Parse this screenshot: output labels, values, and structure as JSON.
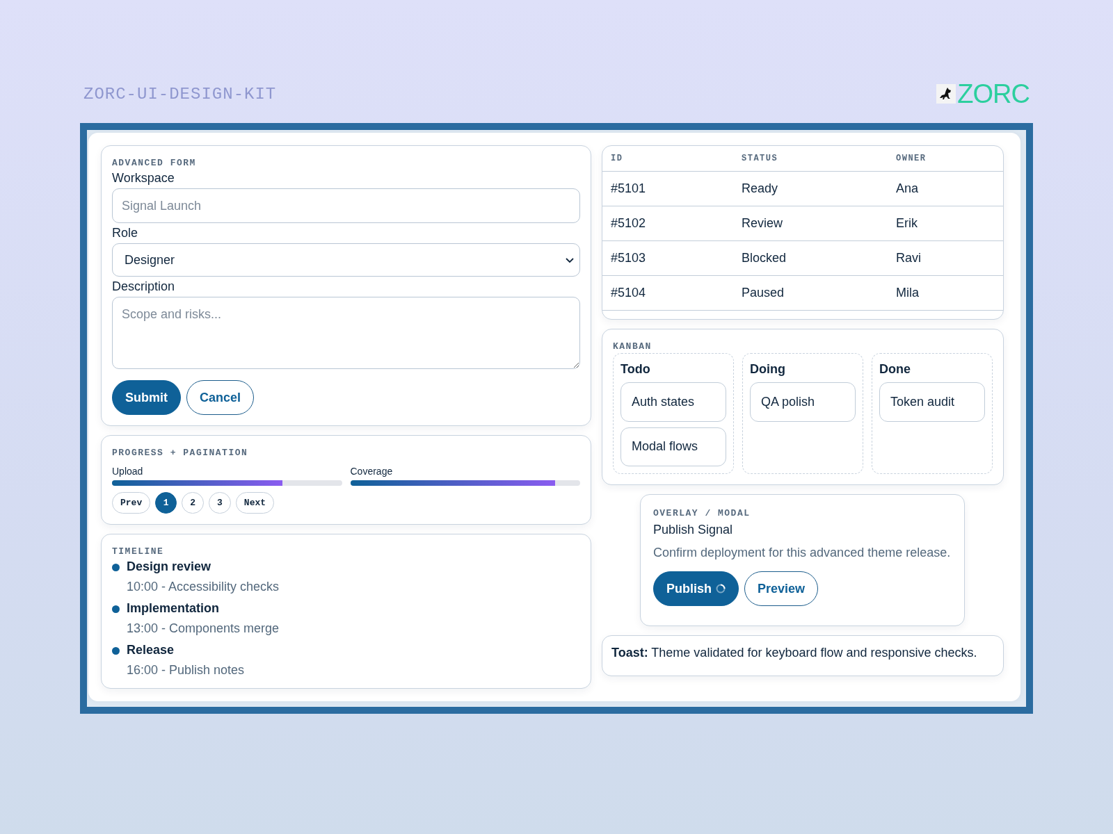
{
  "header": {
    "title": "ZORC-UI-DESIGN-KIT",
    "logo": "ZORC"
  },
  "form": {
    "heading": "ADVANCED FORM",
    "fields": [
      {
        "kind": "input",
        "label": "Workspace",
        "placeholder": "Signal Launch"
      },
      {
        "kind": "select",
        "label": "Role",
        "value": "Designer"
      },
      {
        "kind": "textarea",
        "label": "Description",
        "placeholder": "Scope and risks..."
      }
    ],
    "buttons": [
      {
        "kind": "primary",
        "label": "Submit"
      },
      {
        "kind": "secondary",
        "label": "Cancel"
      }
    ]
  },
  "progress": {
    "heading": "PROGRESS + PAGINATION",
    "bars": [
      {
        "label": "Upload",
        "level": 0.74
      },
      {
        "label": "Coverage",
        "level": 0.89
      }
    ],
    "pagination": [
      {
        "label": "Prev",
        "selected": false
      },
      {
        "label": "1",
        "selected": true
      },
      {
        "label": "2",
        "selected": false
      },
      {
        "label": "3",
        "selected": false
      },
      {
        "label": "Next",
        "selected": false
      }
    ]
  },
  "timeline": {
    "heading": "TIMELINE",
    "events": [
      {
        "title": "Design review",
        "detail": "10:00 - Accessibility checks"
      },
      {
        "title": "Implementation",
        "detail": "13:00 - Components merge"
      },
      {
        "title": "Release",
        "detail": "16:00 - Publish notes"
      }
    ]
  },
  "table": {
    "columns": [
      "ID",
      "STATUS",
      "OWNER"
    ],
    "rows": [
      [
        "#5101",
        "Ready",
        "Ana"
      ],
      [
        "#5102",
        "Review",
        "Erik"
      ],
      [
        "#5103",
        "Blocked",
        "Ravi"
      ],
      [
        "#5104",
        "Paused",
        "Mila"
      ]
    ]
  },
  "kanban": {
    "heading": "KANBAN",
    "columns": [
      {
        "title": "Todo",
        "cards": [
          "Auth states",
          "Modal flows"
        ]
      },
      {
        "title": "Doing",
        "cards": [
          "QA polish"
        ]
      },
      {
        "title": "Done",
        "cards": [
          "Token audit"
        ]
      }
    ]
  },
  "modal": {
    "heading": "OVERLAY / MODAL",
    "title": "Publish Signal",
    "message": "Confirm deployment for this advanced theme release.",
    "buttons": [
      {
        "kind": "primary",
        "label": "Publish",
        "loading": true
      },
      {
        "kind": "secondary",
        "label": "Preview",
        "loading": false
      }
    ]
  },
  "toast": {
    "text": "**Toast:** Theme validated for keyboard flow and responsive checks."
  }
}
